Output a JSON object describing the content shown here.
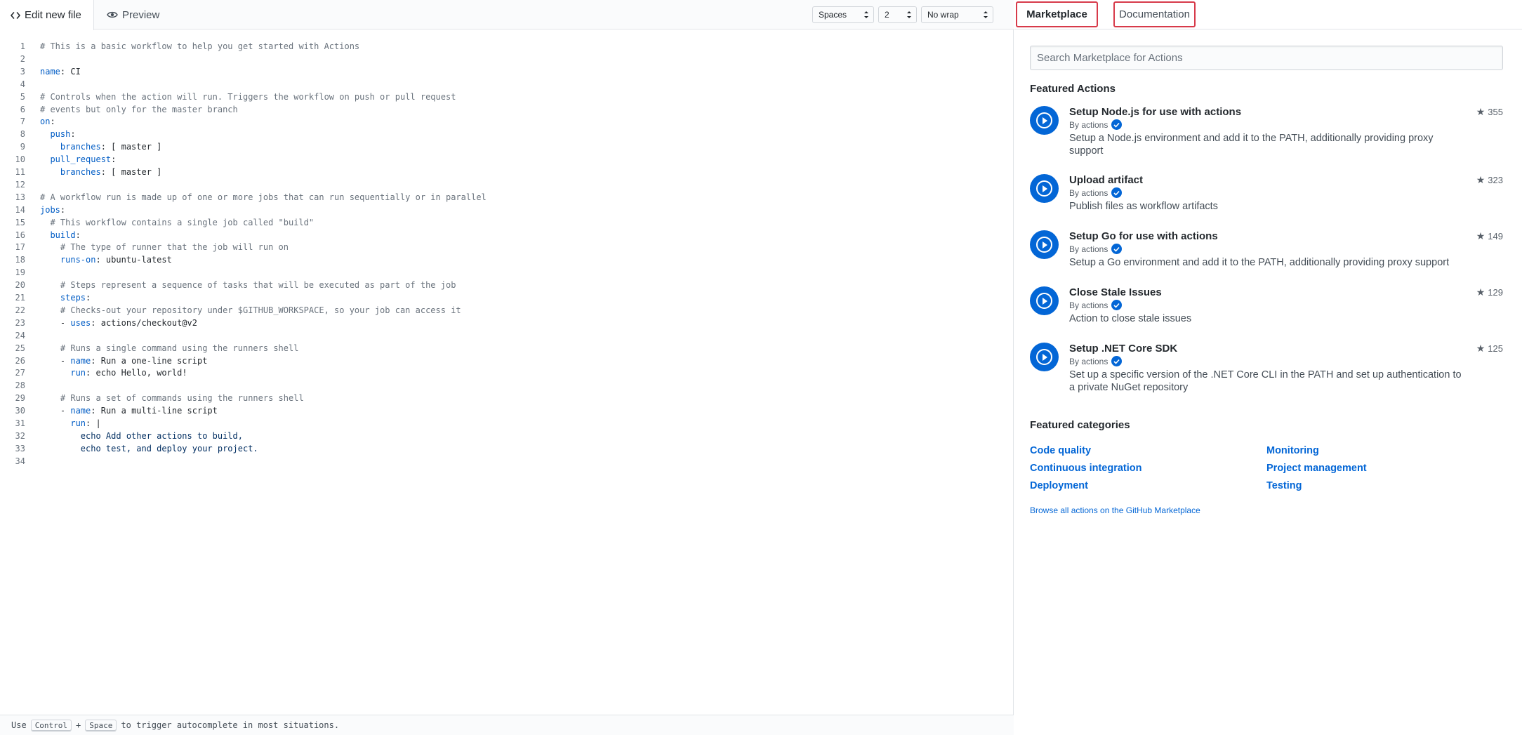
{
  "editor": {
    "tabs": {
      "edit_label": "Edit new file",
      "preview_label": "Preview"
    },
    "selects": {
      "indent_mode": "Spaces",
      "indent_size": "2",
      "wrap_mode": "No wrap"
    },
    "lines": [
      "# This is a basic workflow to help you get started with Actions",
      "",
      "name: CI",
      "",
      "# Controls when the action will run. Triggers the workflow on push or pull request",
      "# events but only for the master branch",
      "on:",
      "  push:",
      "    branches: [ master ]",
      "  pull_request:",
      "    branches: [ master ]",
      "",
      "# A workflow run is made up of one or more jobs that can run sequentially or in parallel",
      "jobs:",
      "  # This workflow contains a single job called \"build\"",
      "  build:",
      "    # The type of runner that the job will run on",
      "    runs-on: ubuntu-latest",
      "",
      "    # Steps represent a sequence of tasks that will be executed as part of the job",
      "    steps:",
      "    # Checks-out your repository under $GITHUB_WORKSPACE, so your job can access it",
      "    - uses: actions/checkout@v2",
      "",
      "    # Runs a single command using the runners shell",
      "    - name: Run a one-line script",
      "      run: echo Hello, world!",
      "",
      "    # Runs a set of commands using the runners shell",
      "    - name: Run a multi-line script",
      "      run: |",
      "        echo Add other actions to build,",
      "        echo test, and deploy your project.",
      ""
    ],
    "footer": {
      "prefix": "Use",
      "key1": "Control",
      "plus": "+",
      "key2": "Space",
      "suffix": "to trigger autocomplete in most situations."
    }
  },
  "side": {
    "tabs": {
      "marketplace_label": "Marketplace",
      "documentation_label": "Documentation"
    },
    "search": {
      "placeholder": "Search Marketplace for Actions"
    },
    "featured_title": "Featured Actions",
    "actions": [
      {
        "name": "Setup Node.js for use with actions",
        "by": "By actions",
        "desc": "Setup a Node.js environment and add it to the PATH, additionally providing proxy support",
        "stars": "355"
      },
      {
        "name": "Upload artifact",
        "by": "By actions",
        "desc": "Publish files as workflow artifacts",
        "stars": "323"
      },
      {
        "name": "Setup Go for use with actions",
        "by": "By actions",
        "desc": "Setup a Go environment and add it to the PATH, additionally providing proxy support",
        "stars": "149"
      },
      {
        "name": "Close Stale Issues",
        "by": "By actions",
        "desc": "Action to close stale issues",
        "stars": "129"
      },
      {
        "name": "Setup .NET Core SDK",
        "by": "By actions",
        "desc": "Set up a specific version of the .NET Core CLI in the PATH and set up authentication to a private NuGet repository",
        "stars": "125"
      }
    ],
    "categories_title": "Featured categories",
    "categories": [
      "Code quality",
      "Monitoring",
      "Continuous integration",
      "Project management",
      "Deployment",
      "Testing"
    ],
    "browse_link": "Browse all actions on the GitHub Marketplace"
  },
  "colors": {
    "link": "#0366d6",
    "highlight_border": "#d73a4a",
    "key": "#005cc5",
    "comment": "#6a737d"
  }
}
